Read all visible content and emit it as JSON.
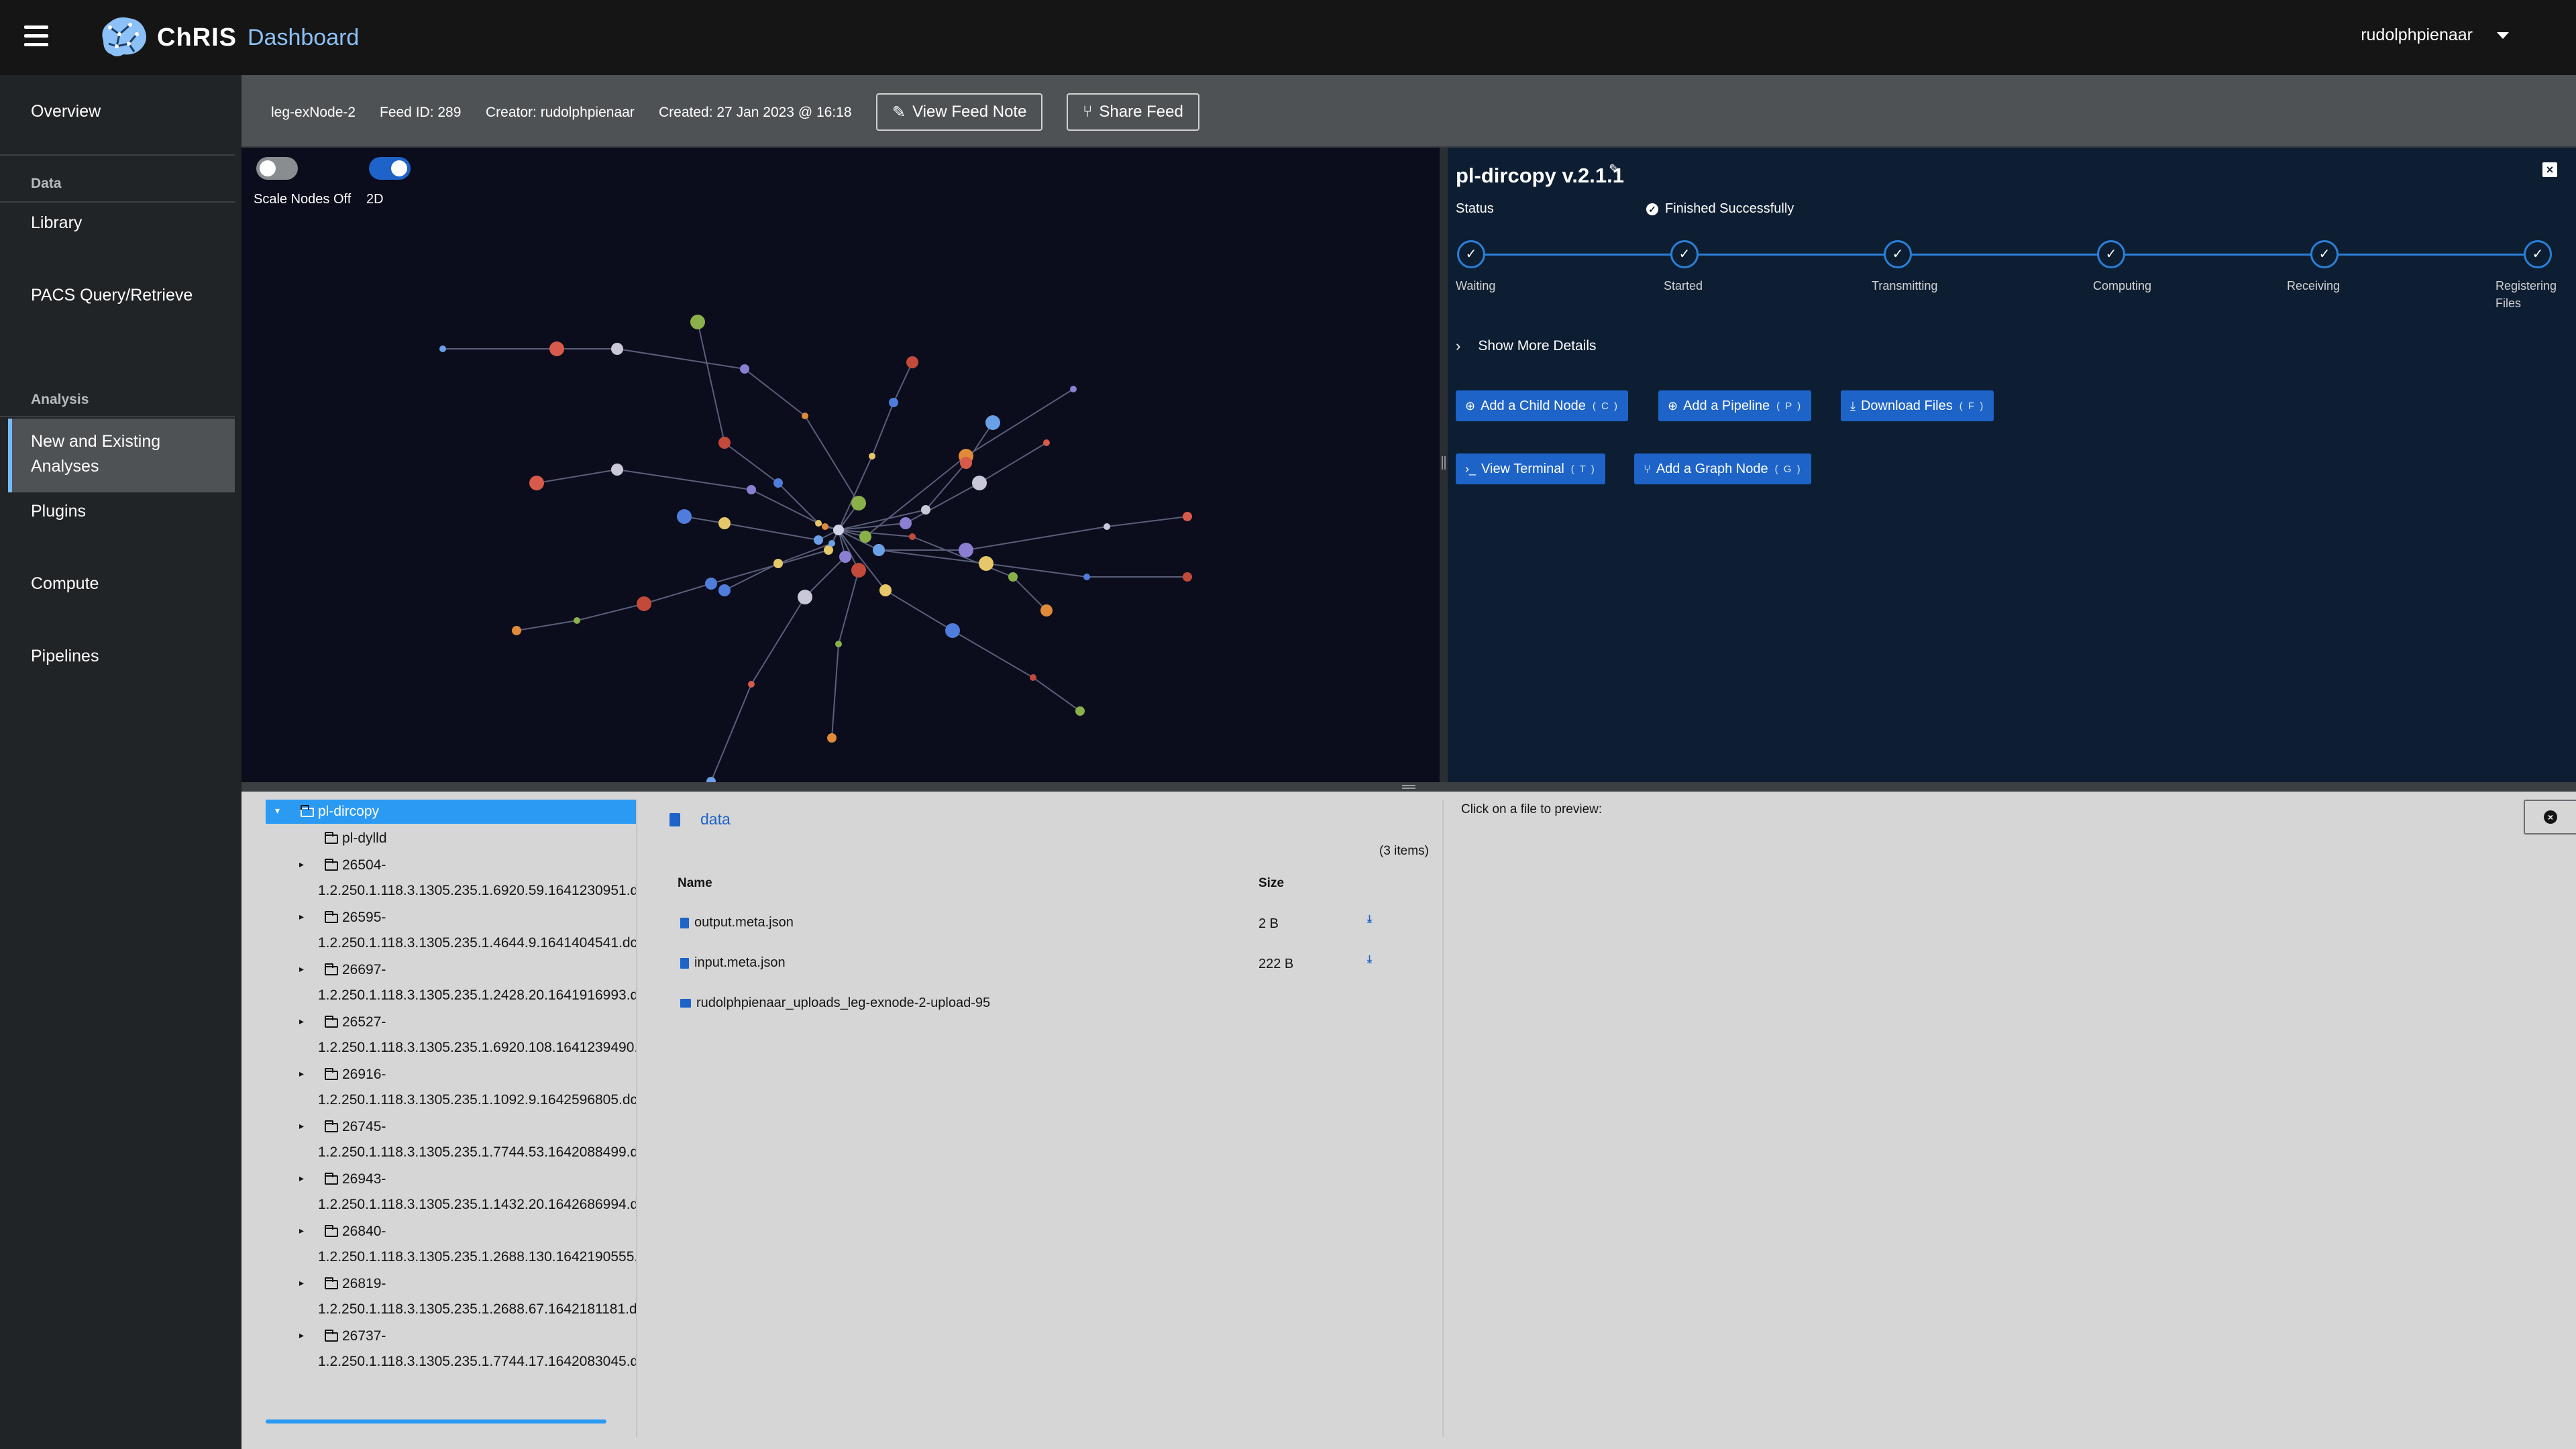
{
  "header": {
    "brand": "ChRIS",
    "subtitle": "Dashboard",
    "user": "rudolphpienaar"
  },
  "sidebar": {
    "overview": "Overview",
    "data_section": "Data",
    "library": "Library",
    "pacs": "PACS Query/Retrieve",
    "analysis_section": "Analysis",
    "analyses": "New and Existing Analyses",
    "plugins": "Plugins",
    "compute": "Compute",
    "pipelines": "Pipelines"
  },
  "feed": {
    "name": "leg-exNode-2",
    "feed_id": "Feed ID: 289",
    "creator": "Creator: rudolphpienaar",
    "created": "Created: 27 Jan 2023 @ 16:18",
    "view_note": "View Feed Note",
    "share": "Share Feed"
  },
  "graph": {
    "scale_nodes_label": "Scale Nodes Off",
    "mode_label": "2D",
    "scale_nodes_on": false,
    "mode_2d_on": true
  },
  "node": {
    "title": "pl-dircopy v.2.1.1",
    "status_label": "Status",
    "status_value": "Finished Successfully",
    "steps": [
      "Waiting",
      "Started",
      "Transmitting",
      "Computing",
      "Receiving",
      "Registering",
      "Files"
    ],
    "show_more": "Show More Details",
    "actions": {
      "add_child": "Add a Child Node",
      "add_child_key": "( C )",
      "add_pipeline": "Add a Pipeline",
      "add_pipeline_key": "( P )",
      "download": "Download Files",
      "download_key": "( F )",
      "terminal": "View Terminal",
      "terminal_key": "( T )",
      "graph_node": "Add a Graph Node",
      "graph_node_key": "( G )"
    }
  },
  "tree": {
    "root": "pl-dircopy",
    "child": "pl-dylld",
    "items": [
      {
        "id": "26504-",
        "sub": "1.2.250.1.118.3.1305.235.1.6920.59.1641230951.dc"
      },
      {
        "id": "26595-",
        "sub": "1.2.250.1.118.3.1305.235.1.4644.9.1641404541.dc"
      },
      {
        "id": "26697-",
        "sub": "1.2.250.1.118.3.1305.235.1.2428.20.1641916993.dc"
      },
      {
        "id": "26527-",
        "sub": "1.2.250.1.118.3.1305.235.1.6920.108.1641239490."
      },
      {
        "id": "26916-",
        "sub": "1.2.250.1.118.3.1305.235.1.1092.9.1642596805.dc"
      },
      {
        "id": "26745-",
        "sub": "1.2.250.1.118.3.1305.235.1.7744.53.1642088499.d"
      },
      {
        "id": "26943-",
        "sub": "1.2.250.1.118.3.1305.235.1.1432.20.1642686994.d"
      },
      {
        "id": "26840-",
        "sub": "1.2.250.1.118.3.1305.235.1.2688.130.1642190555."
      },
      {
        "id": "26819-",
        "sub": "1.2.250.1.118.3.1305.235.1.2688.67.1642181181.d"
      },
      {
        "id": "26737-",
        "sub": "1.2.250.1.118.3.1305.235.1.7744.17.1642083045.d"
      }
    ]
  },
  "browser": {
    "breadcrumb": "data",
    "count": "(3 items)",
    "col_name": "Name",
    "col_size": "Size",
    "files": [
      {
        "name": "output.meta.json",
        "size": "2 B",
        "type": "file"
      },
      {
        "name": "input.meta.json",
        "size": "222 B",
        "type": "file"
      },
      {
        "name": "rudolphpienaar_uploads_leg-exnode-2-upload-95",
        "size": "",
        "type": "folder"
      }
    ],
    "preview_hint": "Click on a file to preview:"
  },
  "colors": {
    "topbar": "#151515",
    "sidebar": "#212427",
    "graph_bg": "#0b0c1c",
    "details_bg": "#0d1e33",
    "accent": "#2b9af3",
    "button": "#1d63c8"
  }
}
